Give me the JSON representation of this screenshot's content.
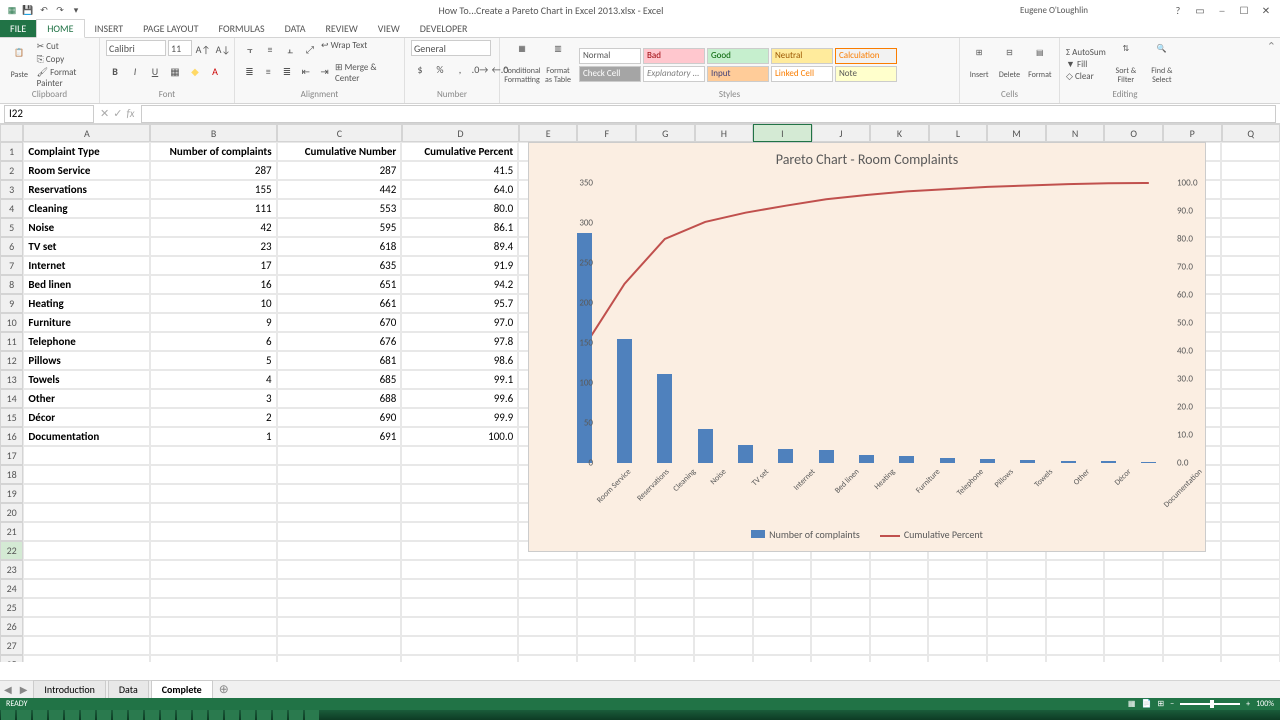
{
  "window": {
    "title": "How To...Create a Pareto Chart in Excel 2013.xlsx - Excel",
    "user": "Eugene O'Loughlin"
  },
  "ribbon": {
    "tabs": [
      "FILE",
      "HOME",
      "INSERT",
      "PAGE LAYOUT",
      "FORMULAS",
      "DATA",
      "REVIEW",
      "VIEW",
      "DEVELOPER"
    ],
    "active": "HOME",
    "clipboard": {
      "cut": "Cut",
      "copy": "Copy",
      "fp": "Format Painter",
      "paste": "Paste",
      "label": "Clipboard"
    },
    "font": {
      "name": "Calibri",
      "size": "11",
      "label": "Font"
    },
    "alignment": {
      "wrap": "Wrap Text",
      "merge": "Merge & Center",
      "label": "Alignment"
    },
    "number": {
      "fmt": "General",
      "label": "Number"
    },
    "styles": {
      "cf": "Conditional Formatting",
      "fat": "Format as Table",
      "label": "Styles",
      "cells": {
        "normal": "Normal",
        "bad": "Bad",
        "good": "Good",
        "neutral": "Neutral",
        "calc": "Calculation",
        "check": "Check Cell",
        "expl": "Explanatory ...",
        "input": "Input",
        "linked": "Linked Cell",
        "note": "Note"
      }
    },
    "cells": {
      "insert": "Insert",
      "delete": "Delete",
      "format": "Format",
      "label": "Cells"
    },
    "editing": {
      "autosum": "AutoSum",
      "fill": "Fill",
      "clear": "Clear",
      "sort": "Sort & Filter",
      "find": "Find & Select",
      "label": "Editing"
    }
  },
  "namebox": "I22",
  "columns": [
    "A",
    "B",
    "C",
    "D",
    "E",
    "F",
    "G",
    "H",
    "I",
    "J",
    "K",
    "L",
    "M",
    "N",
    "O",
    "P",
    "Q"
  ],
  "headers": [
    "Complaint Type",
    "Number of complaints",
    "Cumulative Number",
    "Cumulative Percent"
  ],
  "rows": [
    {
      "type": "Room Service",
      "n": 287,
      "cum": 287,
      "pct": "41.5"
    },
    {
      "type": "Reservations",
      "n": 155,
      "cum": 442,
      "pct": "64.0"
    },
    {
      "type": "Cleaning",
      "n": 111,
      "cum": 553,
      "pct": "80.0"
    },
    {
      "type": "Noise",
      "n": 42,
      "cum": 595,
      "pct": "86.1"
    },
    {
      "type": "TV set",
      "n": 23,
      "cum": 618,
      "pct": "89.4"
    },
    {
      "type": "Internet",
      "n": 17,
      "cum": 635,
      "pct": "91.9"
    },
    {
      "type": "Bed linen",
      "n": 16,
      "cum": 651,
      "pct": "94.2"
    },
    {
      "type": "Heating",
      "n": 10,
      "cum": 661,
      "pct": "95.7"
    },
    {
      "type": "Furniture",
      "n": 9,
      "cum": 670,
      "pct": "97.0"
    },
    {
      "type": "Telephone",
      "n": 6,
      "cum": 676,
      "pct": "97.8"
    },
    {
      "type": "Pillows",
      "n": 5,
      "cum": 681,
      "pct": "98.6"
    },
    {
      "type": "Towels",
      "n": 4,
      "cum": 685,
      "pct": "99.1"
    },
    {
      "type": "Other",
      "n": 3,
      "cum": 688,
      "pct": "99.6"
    },
    {
      "type": "Décor",
      "n": 2,
      "cum": 690,
      "pct": "99.9"
    },
    {
      "type": "Documentation",
      "n": 1,
      "cum": 691,
      "pct": "100.0"
    }
  ],
  "sheet_tabs": [
    "Introduction",
    "Data",
    "Complete"
  ],
  "active_sheet": "Complete",
  "status": {
    "ready": "READY",
    "zoom": "100%"
  },
  "chart": {
    "title": "Pareto Chart - Room Complaints",
    "legend": {
      "bars": "Number of complaints",
      "line": "Cumulative Percent"
    },
    "y1": {
      "ticks": [
        0,
        50,
        100,
        150,
        200,
        250,
        300,
        350
      ],
      "max": 350
    },
    "y2": {
      "ticks": [
        "0.0",
        "10.0",
        "20.0",
        "30.0",
        "40.0",
        "50.0",
        "60.0",
        "70.0",
        "80.0",
        "90.0",
        "100.0"
      ],
      "max": 100
    }
  },
  "chart_data": {
    "type": "pareto",
    "title": "Pareto Chart - Room Complaints",
    "categories": [
      "Room Service",
      "Reservations",
      "Cleaning",
      "Noise",
      "TV set",
      "Internet",
      "Bed linen",
      "Heating",
      "Furniture",
      "Telephone",
      "Pillows",
      "Towels",
      "Other",
      "Décor",
      "Documentation"
    ],
    "series": [
      {
        "name": "Number of complaints",
        "type": "bar",
        "axis": "primary",
        "values": [
          287,
          155,
          111,
          42,
          23,
          17,
          16,
          10,
          9,
          6,
          5,
          4,
          3,
          2,
          1
        ]
      },
      {
        "name": "Cumulative Percent",
        "type": "line",
        "axis": "secondary",
        "values": [
          41.5,
          64.0,
          80.0,
          86.1,
          89.4,
          91.9,
          94.2,
          95.7,
          97.0,
          97.8,
          98.6,
          99.1,
          99.6,
          99.9,
          100.0
        ]
      }
    ],
    "y1_axis": {
      "min": 0,
      "max": 350,
      "label": ""
    },
    "y2_axis": {
      "min": 0,
      "max": 100,
      "label": ""
    }
  }
}
